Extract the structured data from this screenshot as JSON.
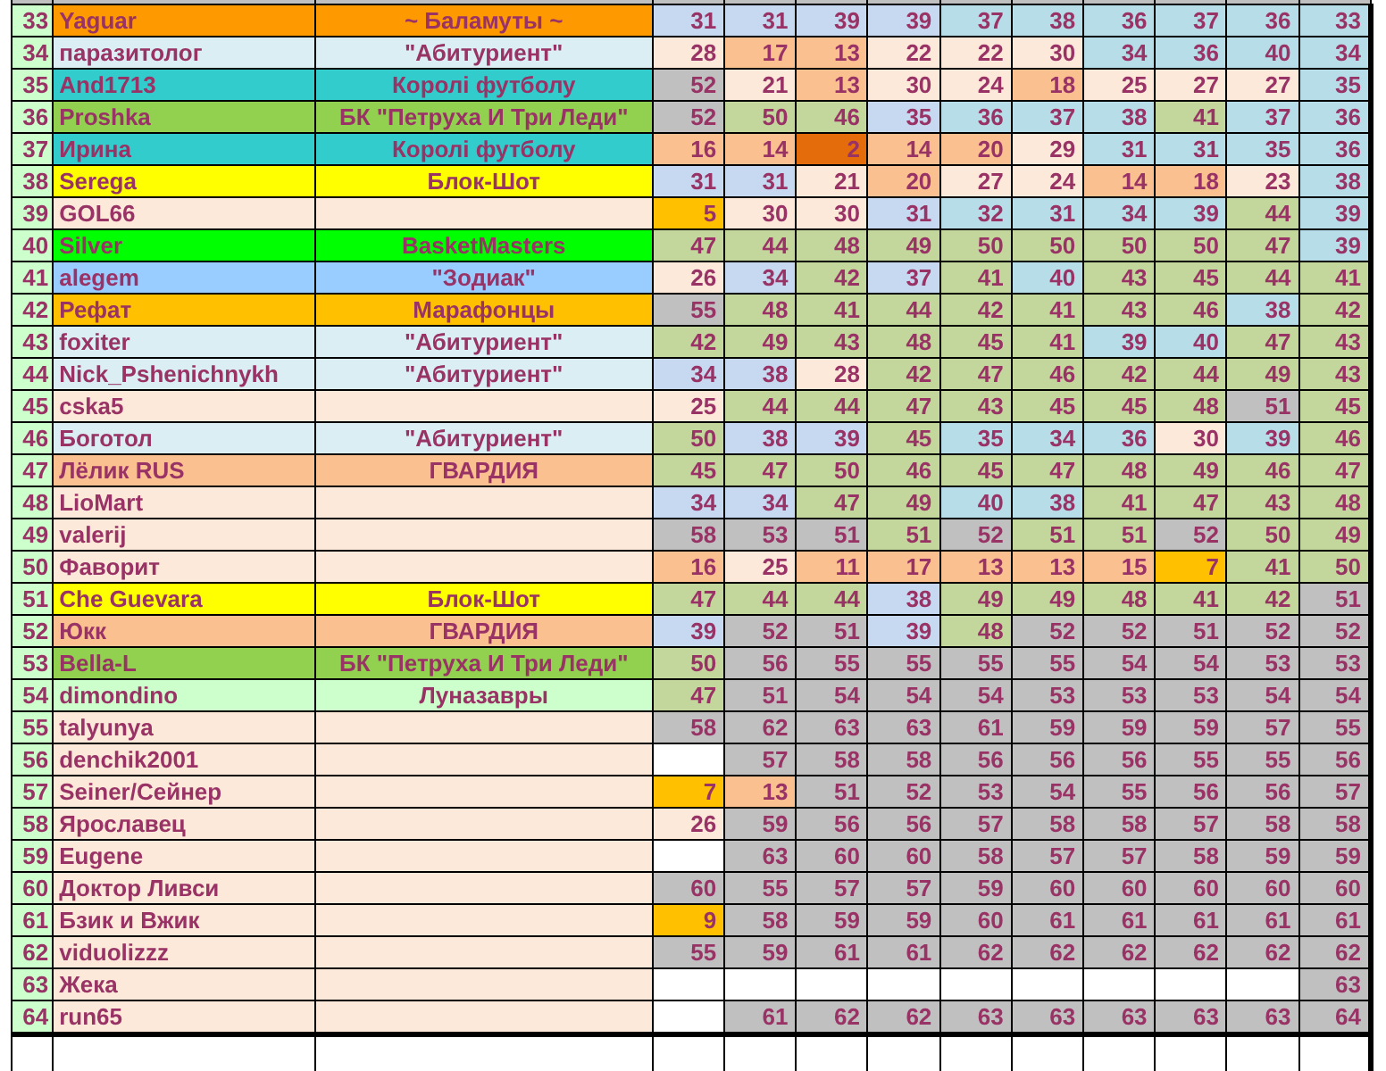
{
  "rows": [
    {
      "number": "33",
      "name": "Yaguar",
      "team": "~ Баламуты ~",
      "color": "#ff9900",
      "cells": [
        {
          "value": "31",
          "color": "#c6d9f0"
        },
        {
          "value": "31",
          "color": "#c6d9f0"
        },
        {
          "value": "39",
          "color": "#c6d9f0"
        },
        {
          "value": "39",
          "color": "#c6d9f0"
        },
        {
          "value": "37",
          "color": "#b7dde8"
        },
        {
          "value": "38",
          "color": "#b7dde8"
        },
        {
          "value": "36",
          "color": "#b7dde8"
        },
        {
          "value": "37",
          "color": "#b7dde8"
        },
        {
          "value": "36",
          "color": "#b7dde8"
        },
        {
          "value": "33",
          "color": "#b7dde8"
        }
      ]
    },
    {
      "number": "34",
      "name": "паразитолог",
      "team": "\"Абитуриент\"",
      "color": "#daeef3",
      "cells": [
        {
          "value": "28",
          "color": "#fde9d9"
        },
        {
          "value": "17",
          "color": "#fac090"
        },
        {
          "value": "13",
          "color": "#fac090"
        },
        {
          "value": "22",
          "color": "#fde9d9"
        },
        {
          "value": "22",
          "color": "#fde9d9"
        },
        {
          "value": "30",
          "color": "#fde9d9"
        },
        {
          "value": "34",
          "color": "#b7dde8"
        },
        {
          "value": "36",
          "color": "#b7dde8"
        },
        {
          "value": "40",
          "color": "#b7dde8"
        },
        {
          "value": "34",
          "color": "#b7dde8"
        }
      ]
    },
    {
      "number": "35",
      "name": "And1713",
      "team": "Королі футболу",
      "color": "#33cccc",
      "cells": [
        {
          "value": "52",
          "color": "#c0c0c0"
        },
        {
          "value": "21",
          "color": "#fde9d9"
        },
        {
          "value": "13",
          "color": "#fac090"
        },
        {
          "value": "30",
          "color": "#fde9d9"
        },
        {
          "value": "24",
          "color": "#fde9d9"
        },
        {
          "value": "18",
          "color": "#fac090"
        },
        {
          "value": "25",
          "color": "#fde9d9"
        },
        {
          "value": "27",
          "color": "#fde9d9"
        },
        {
          "value": "27",
          "color": "#fde9d9"
        },
        {
          "value": "35",
          "color": "#b7dde8"
        }
      ]
    },
    {
      "number": "36",
      "name": "Proshka",
      "team": "БК \"Петруха И Три Леди\"",
      "color": "#92d050",
      "cells": [
        {
          "value": "52",
          "color": "#c0c0c0"
        },
        {
          "value": "50",
          "color": "#c3d69b"
        },
        {
          "value": "46",
          "color": "#c3d69b"
        },
        {
          "value": "35",
          "color": "#c6d9f0"
        },
        {
          "value": "36",
          "color": "#b7dde8"
        },
        {
          "value": "37",
          "color": "#b7dde8"
        },
        {
          "value": "38",
          "color": "#b7dde8"
        },
        {
          "value": "41",
          "color": "#c3d69b"
        },
        {
          "value": "37",
          "color": "#b7dde8"
        },
        {
          "value": "36",
          "color": "#b7dde8"
        }
      ]
    },
    {
      "number": "37",
      "name": "Ирина",
      "team": "Королі футболу",
      "color": "#33cccc",
      "cells": [
        {
          "value": "16",
          "color": "#fac090"
        },
        {
          "value": "14",
          "color": "#fac090"
        },
        {
          "value": "2",
          "color": "#e46c0a"
        },
        {
          "value": "14",
          "color": "#fac090"
        },
        {
          "value": "20",
          "color": "#fac090"
        },
        {
          "value": "29",
          "color": "#fde9d9"
        },
        {
          "value": "31",
          "color": "#b7dde8"
        },
        {
          "value": "31",
          "color": "#b7dde8"
        },
        {
          "value": "35",
          "color": "#b7dde8"
        },
        {
          "value": "36",
          "color": "#b7dde8"
        }
      ]
    },
    {
      "number": "38",
      "name": "Serega",
      "team": "Блок-Шот",
      "color": "#ffff00",
      "cells": [
        {
          "value": "31",
          "color": "#c6d9f0"
        },
        {
          "value": "31",
          "color": "#c6d9f0"
        },
        {
          "value": "21",
          "color": "#fde9d9"
        },
        {
          "value": "20",
          "color": "#fac090"
        },
        {
          "value": "27",
          "color": "#fde9d9"
        },
        {
          "value": "24",
          "color": "#fde9d9"
        },
        {
          "value": "14",
          "color": "#fac090"
        },
        {
          "value": "18",
          "color": "#fac090"
        },
        {
          "value": "23",
          "color": "#fde9d9"
        },
        {
          "value": "38",
          "color": "#b7dde8"
        }
      ]
    },
    {
      "number": "39",
      "name": "GOL66",
      "color": "#fde9d9",
      "cells": [
        {
          "value": "5",
          "color": "#ffc000"
        },
        {
          "value": "30",
          "color": "#fde9d9"
        },
        {
          "value": "30",
          "color": "#fde9d9"
        },
        {
          "value": "31",
          "color": "#c6d9f0"
        },
        {
          "value": "32",
          "color": "#b7dde8"
        },
        {
          "value": "31",
          "color": "#b7dde8"
        },
        {
          "value": "34",
          "color": "#b7dde8"
        },
        {
          "value": "39",
          "color": "#b7dde8"
        },
        {
          "value": "44",
          "color": "#c3d69b"
        },
        {
          "value": "39",
          "color": "#b7dde8"
        }
      ]
    },
    {
      "number": "40",
      "name": "Silver",
      "team": "BasketMasters",
      "color": "#00ff00",
      "cells": [
        {
          "value": "47",
          "color": "#c3d69b"
        },
        {
          "value": "44",
          "color": "#c3d69b"
        },
        {
          "value": "48",
          "color": "#c3d69b"
        },
        {
          "value": "49",
          "color": "#c3d69b"
        },
        {
          "value": "50",
          "color": "#c3d69b"
        },
        {
          "value": "50",
          "color": "#c3d69b"
        },
        {
          "value": "50",
          "color": "#c3d69b"
        },
        {
          "value": "50",
          "color": "#c3d69b"
        },
        {
          "value": "47",
          "color": "#c3d69b"
        },
        {
          "value": "39",
          "color": "#b7dde8"
        }
      ]
    },
    {
      "number": "41",
      "name": "alegem",
      "team": "\"Зодиак\"",
      "color": "#99ccff",
      "cells": [
        {
          "value": "26",
          "color": "#fde9d9"
        },
        {
          "value": "34",
          "color": "#c6d9f0"
        },
        {
          "value": "42",
          "color": "#c3d69b"
        },
        {
          "value": "37",
          "color": "#c6d9f0"
        },
        {
          "value": "41",
          "color": "#c3d69b"
        },
        {
          "value": "40",
          "color": "#b7dde8"
        },
        {
          "value": "43",
          "color": "#c3d69b"
        },
        {
          "value": "45",
          "color": "#c3d69b"
        },
        {
          "value": "44",
          "color": "#c3d69b"
        },
        {
          "value": "41",
          "color": "#c3d69b"
        }
      ]
    },
    {
      "number": "42",
      "name": "Рефат",
      "team": "Марафонцы",
      "color": "#ffc000",
      "cells": [
        {
          "value": "55",
          "color": "#c0c0c0"
        },
        {
          "value": "48",
          "color": "#c3d69b"
        },
        {
          "value": "41",
          "color": "#c3d69b"
        },
        {
          "value": "44",
          "color": "#c3d69b"
        },
        {
          "value": "42",
          "color": "#c3d69b"
        },
        {
          "value": "41",
          "color": "#c3d69b"
        },
        {
          "value": "43",
          "color": "#c3d69b"
        },
        {
          "value": "46",
          "color": "#c3d69b"
        },
        {
          "value": "38",
          "color": "#b7dde8"
        },
        {
          "value": "42",
          "color": "#c3d69b"
        }
      ]
    },
    {
      "number": "43",
      "name": "foxiter",
      "team": "\"Абитуриент\"",
      "color": "#daeef3",
      "cells": [
        {
          "value": "42",
          "color": "#c3d69b"
        },
        {
          "value": "49",
          "color": "#c3d69b"
        },
        {
          "value": "43",
          "color": "#c3d69b"
        },
        {
          "value": "48",
          "color": "#c3d69b"
        },
        {
          "value": "45",
          "color": "#c3d69b"
        },
        {
          "value": "41",
          "color": "#c3d69b"
        },
        {
          "value": "39",
          "color": "#b7dde8"
        },
        {
          "value": "40",
          "color": "#b7dde8"
        },
        {
          "value": "47",
          "color": "#c3d69b"
        },
        {
          "value": "43",
          "color": "#c3d69b"
        }
      ]
    },
    {
      "number": "44",
      "name": "Nick_Pshenichnykh",
      "team": "\"Абитуриент\"",
      "color": "#daeef3",
      "cells": [
        {
          "value": "34",
          "color": "#c6d9f0"
        },
        {
          "value": "38",
          "color": "#c6d9f0"
        },
        {
          "value": "28",
          "color": "#fde9d9"
        },
        {
          "value": "42",
          "color": "#c3d69b"
        },
        {
          "value": "47",
          "color": "#c3d69b"
        },
        {
          "value": "46",
          "color": "#c3d69b"
        },
        {
          "value": "42",
          "color": "#c3d69b"
        },
        {
          "value": "44",
          "color": "#c3d69b"
        },
        {
          "value": "49",
          "color": "#c3d69b"
        },
        {
          "value": "43",
          "color": "#c3d69b"
        }
      ]
    },
    {
      "number": "45",
      "name": "cska5",
      "color": "#fde9d9",
      "cells": [
        {
          "value": "25",
          "color": "#fde9d9"
        },
        {
          "value": "44",
          "color": "#c3d69b"
        },
        {
          "value": "44",
          "color": "#c3d69b"
        },
        {
          "value": "47",
          "color": "#c3d69b"
        },
        {
          "value": "43",
          "color": "#c3d69b"
        },
        {
          "value": "45",
          "color": "#c3d69b"
        },
        {
          "value": "45",
          "color": "#c3d69b"
        },
        {
          "value": "48",
          "color": "#c3d69b"
        },
        {
          "value": "51",
          "color": "#c0c0c0"
        },
        {
          "value": "45",
          "color": "#c3d69b"
        }
      ]
    },
    {
      "number": "46",
      "name": "Боготол",
      "team": "\"Абитуриент\"",
      "color": "#daeef3",
      "cells": [
        {
          "value": "50",
          "color": "#c3d69b"
        },
        {
          "value": "38",
          "color": "#c6d9f0"
        },
        {
          "value": "39",
          "color": "#c6d9f0"
        },
        {
          "value": "45",
          "color": "#c3d69b"
        },
        {
          "value": "35",
          "color": "#b7dde8"
        },
        {
          "value": "34",
          "color": "#b7dde8"
        },
        {
          "value": "36",
          "color": "#b7dde8"
        },
        {
          "value": "30",
          "color": "#fde9d9"
        },
        {
          "value": "39",
          "color": "#b7dde8"
        },
        {
          "value": "46",
          "color": "#c3d69b"
        }
      ]
    },
    {
      "number": "47",
      "name": "Лёлик RUS",
      "team": "ГВАРДИЯ",
      "color": "#fac090",
      "cells": [
        {
          "value": "45",
          "color": "#c3d69b"
        },
        {
          "value": "47",
          "color": "#c3d69b"
        },
        {
          "value": "50",
          "color": "#c3d69b"
        },
        {
          "value": "46",
          "color": "#c3d69b"
        },
        {
          "value": "45",
          "color": "#c3d69b"
        },
        {
          "value": "47",
          "color": "#c3d69b"
        },
        {
          "value": "48",
          "color": "#c3d69b"
        },
        {
          "value": "49",
          "color": "#c3d69b"
        },
        {
          "value": "46",
          "color": "#c3d69b"
        },
        {
          "value": "47",
          "color": "#c3d69b"
        }
      ]
    },
    {
      "number": "48",
      "name": "LioMart",
      "color": "#fde9d9",
      "cells": [
        {
          "value": "34",
          "color": "#c6d9f0"
        },
        {
          "value": "34",
          "color": "#c6d9f0"
        },
        {
          "value": "47",
          "color": "#c3d69b"
        },
        {
          "value": "49",
          "color": "#c3d69b"
        },
        {
          "value": "40",
          "color": "#b7dde8"
        },
        {
          "value": "38",
          "color": "#b7dde8"
        },
        {
          "value": "41",
          "color": "#c3d69b"
        },
        {
          "value": "47",
          "color": "#c3d69b"
        },
        {
          "value": "43",
          "color": "#c3d69b"
        },
        {
          "value": "48",
          "color": "#c3d69b"
        }
      ]
    },
    {
      "number": "49",
      "name": "valerij",
      "color": "#fde9d9",
      "cells": [
        {
          "value": "58",
          "color": "#c0c0c0"
        },
        {
          "value": "53",
          "color": "#c0c0c0"
        },
        {
          "value": "51",
          "color": "#c0c0c0"
        },
        {
          "value": "51",
          "color": "#c3d69b"
        },
        {
          "value": "52",
          "color": "#c0c0c0"
        },
        {
          "value": "51",
          "color": "#c3d69b"
        },
        {
          "value": "51",
          "color": "#c3d69b"
        },
        {
          "value": "52",
          "color": "#c0c0c0"
        },
        {
          "value": "50",
          "color": "#c3d69b"
        },
        {
          "value": "49",
          "color": "#c3d69b"
        }
      ]
    },
    {
      "number": "50",
      "name": "Фаворит",
      "color": "#fde9d9",
      "cells": [
        {
          "value": "16",
          "color": "#fac090"
        },
        {
          "value": "25",
          "color": "#fde9d9"
        },
        {
          "value": "11",
          "color": "#fac090"
        },
        {
          "value": "17",
          "color": "#fac090"
        },
        {
          "value": "13",
          "color": "#fac090"
        },
        {
          "value": "13",
          "color": "#fac090"
        },
        {
          "value": "15",
          "color": "#fac090"
        },
        {
          "value": "7",
          "color": "#ffc000"
        },
        {
          "value": "41",
          "color": "#c3d69b"
        },
        {
          "value": "50",
          "color": "#c3d69b"
        }
      ]
    },
    {
      "number": "51",
      "name": "Che Guevara",
      "team": "Блок-Шот",
      "color": "#ffff00",
      "cells": [
        {
          "value": "47",
          "color": "#c3d69b"
        },
        {
          "value": "44",
          "color": "#c3d69b"
        },
        {
          "value": "44",
          "color": "#c3d69b"
        },
        {
          "value": "38",
          "color": "#c6d9f0"
        },
        {
          "value": "49",
          "color": "#c3d69b"
        },
        {
          "value": "49",
          "color": "#c3d69b"
        },
        {
          "value": "48",
          "color": "#c3d69b"
        },
        {
          "value": "41",
          "color": "#c3d69b"
        },
        {
          "value": "42",
          "color": "#c3d69b"
        },
        {
          "value": "51",
          "color": "#c0c0c0"
        }
      ]
    },
    {
      "number": "52",
      "name": "Юкк",
      "team": "ГВАРДИЯ",
      "color": "#fac090",
      "cells": [
        {
          "value": "39",
          "color": "#c6d9f0"
        },
        {
          "value": "52",
          "color": "#c0c0c0"
        },
        {
          "value": "51",
          "color": "#c0c0c0"
        },
        {
          "value": "39",
          "color": "#c6d9f0"
        },
        {
          "value": "48",
          "color": "#c3d69b"
        },
        {
          "value": "52",
          "color": "#c0c0c0"
        },
        {
          "value": "52",
          "color": "#c0c0c0"
        },
        {
          "value": "51",
          "color": "#c0c0c0"
        },
        {
          "value": "52",
          "color": "#c0c0c0"
        },
        {
          "value": "52",
          "color": "#c0c0c0"
        }
      ]
    },
    {
      "number": "53",
      "name": "Bella-L",
      "team": "БК \"Петруха И Три Леди\"",
      "color": "#92d050",
      "cells": [
        {
          "value": "50",
          "color": "#c3d69b"
        },
        {
          "value": "56",
          "color": "#c0c0c0"
        },
        {
          "value": "55",
          "color": "#c0c0c0"
        },
        {
          "value": "55",
          "color": "#c0c0c0"
        },
        {
          "value": "55",
          "color": "#c0c0c0"
        },
        {
          "value": "55",
          "color": "#c0c0c0"
        },
        {
          "value": "54",
          "color": "#c0c0c0"
        },
        {
          "value": "54",
          "color": "#c0c0c0"
        },
        {
          "value": "53",
          "color": "#c0c0c0"
        },
        {
          "value": "53",
          "color": "#c0c0c0"
        }
      ]
    },
    {
      "number": "54",
      "name": "dimondino",
      "team": "Луназавры",
      "color": "#ccffcc",
      "cells": [
        {
          "value": "47",
          "color": "#c3d69b"
        },
        {
          "value": "51",
          "color": "#c0c0c0"
        },
        {
          "value": "54",
          "color": "#c0c0c0"
        },
        {
          "value": "54",
          "color": "#c0c0c0"
        },
        {
          "value": "54",
          "color": "#c0c0c0"
        },
        {
          "value": "53",
          "color": "#c0c0c0"
        },
        {
          "value": "53",
          "color": "#c0c0c0"
        },
        {
          "value": "53",
          "color": "#c0c0c0"
        },
        {
          "value": "54",
          "color": "#c0c0c0"
        },
        {
          "value": "54",
          "color": "#c0c0c0"
        }
      ]
    },
    {
      "number": "55",
      "name": "talyunya",
      "color": "#fde9d9",
      "cells": [
        {
          "value": "58",
          "color": "#c0c0c0"
        },
        {
          "value": "62",
          "color": "#c0c0c0"
        },
        {
          "value": "63",
          "color": "#c0c0c0"
        },
        {
          "value": "63",
          "color": "#c0c0c0"
        },
        {
          "value": "61",
          "color": "#c0c0c0"
        },
        {
          "value": "59",
          "color": "#c0c0c0"
        },
        {
          "value": "59",
          "color": "#c0c0c0"
        },
        {
          "value": "59",
          "color": "#c0c0c0"
        },
        {
          "value": "57",
          "color": "#c0c0c0"
        },
        {
          "value": "55",
          "color": "#c0c0c0"
        }
      ]
    },
    {
      "number": "56",
      "name": "denchik2001",
      "color": "#fde9d9",
      "cells": [
        {
          "color": "#ffffff"
        },
        {
          "value": "57",
          "color": "#c0c0c0"
        },
        {
          "value": "58",
          "color": "#c0c0c0"
        },
        {
          "value": "58",
          "color": "#c0c0c0"
        },
        {
          "value": "56",
          "color": "#c0c0c0"
        },
        {
          "value": "56",
          "color": "#c0c0c0"
        },
        {
          "value": "56",
          "color": "#c0c0c0"
        },
        {
          "value": "55",
          "color": "#c0c0c0"
        },
        {
          "value": "55",
          "color": "#c0c0c0"
        },
        {
          "value": "56",
          "color": "#c0c0c0"
        }
      ]
    },
    {
      "number": "57",
      "name": "Seiner/Сейнер",
      "color": "#fde9d9",
      "cells": [
        {
          "value": "7",
          "color": "#ffc000"
        },
        {
          "value": "13",
          "color": "#fac090"
        },
        {
          "value": "51",
          "color": "#c0c0c0"
        },
        {
          "value": "52",
          "color": "#c0c0c0"
        },
        {
          "value": "53",
          "color": "#c0c0c0"
        },
        {
          "value": "54",
          "color": "#c0c0c0"
        },
        {
          "value": "55",
          "color": "#c0c0c0"
        },
        {
          "value": "56",
          "color": "#c0c0c0"
        },
        {
          "value": "56",
          "color": "#c0c0c0"
        },
        {
          "value": "57",
          "color": "#c0c0c0"
        }
      ]
    },
    {
      "number": "58",
      "name": "Ярославец",
      "color": "#fde9d9",
      "cells": [
        {
          "value": "26",
          "color": "#fde9d9"
        },
        {
          "value": "59",
          "color": "#c0c0c0"
        },
        {
          "value": "56",
          "color": "#c0c0c0"
        },
        {
          "value": "56",
          "color": "#c0c0c0"
        },
        {
          "value": "57",
          "color": "#c0c0c0"
        },
        {
          "value": "58",
          "color": "#c0c0c0"
        },
        {
          "value": "58",
          "color": "#c0c0c0"
        },
        {
          "value": "57",
          "color": "#c0c0c0"
        },
        {
          "value": "58",
          "color": "#c0c0c0"
        },
        {
          "value": "58",
          "color": "#c0c0c0"
        }
      ]
    },
    {
      "number": "59",
      "name": "Eugene",
      "color": "#fde9d9",
      "cells": [
        {
          "color": "#ffffff"
        },
        {
          "value": "63",
          "color": "#c0c0c0"
        },
        {
          "value": "60",
          "color": "#c0c0c0"
        },
        {
          "value": "60",
          "color": "#c0c0c0"
        },
        {
          "value": "58",
          "color": "#c0c0c0"
        },
        {
          "value": "57",
          "color": "#c0c0c0"
        },
        {
          "value": "57",
          "color": "#c0c0c0"
        },
        {
          "value": "58",
          "color": "#c0c0c0"
        },
        {
          "value": "59",
          "color": "#c0c0c0"
        },
        {
          "value": "59",
          "color": "#c0c0c0"
        }
      ]
    },
    {
      "number": "60",
      "name": "Доктор Ливси",
      "color": "#fde9d9",
      "cells": [
        {
          "value": "60",
          "color": "#c0c0c0"
        },
        {
          "value": "55",
          "color": "#c0c0c0"
        },
        {
          "value": "57",
          "color": "#c0c0c0"
        },
        {
          "value": "57",
          "color": "#c0c0c0"
        },
        {
          "value": "59",
          "color": "#c0c0c0"
        },
        {
          "value": "60",
          "color": "#c0c0c0"
        },
        {
          "value": "60",
          "color": "#c0c0c0"
        },
        {
          "value": "60",
          "color": "#c0c0c0"
        },
        {
          "value": "60",
          "color": "#c0c0c0"
        },
        {
          "value": "60",
          "color": "#c0c0c0"
        }
      ]
    },
    {
      "number": "61",
      "name": "Бзик и Вжик",
      "color": "#fde9d9",
      "cells": [
        {
          "value": "9",
          "color": "#ffc000"
        },
        {
          "value": "58",
          "color": "#c0c0c0"
        },
        {
          "value": "59",
          "color": "#c0c0c0"
        },
        {
          "value": "59",
          "color": "#c0c0c0"
        },
        {
          "value": "60",
          "color": "#c0c0c0"
        },
        {
          "value": "61",
          "color": "#c0c0c0"
        },
        {
          "value": "61",
          "color": "#c0c0c0"
        },
        {
          "value": "61",
          "color": "#c0c0c0"
        },
        {
          "value": "61",
          "color": "#c0c0c0"
        },
        {
          "value": "61",
          "color": "#c0c0c0"
        }
      ]
    },
    {
      "number": "62",
      "name": "viduolizzz",
      "color": "#fde9d9",
      "cells": [
        {
          "value": "55",
          "color": "#c0c0c0"
        },
        {
          "value": "59",
          "color": "#c0c0c0"
        },
        {
          "value": "61",
          "color": "#c0c0c0"
        },
        {
          "value": "61",
          "color": "#c0c0c0"
        },
        {
          "value": "62",
          "color": "#c0c0c0"
        },
        {
          "value": "62",
          "color": "#c0c0c0"
        },
        {
          "value": "62",
          "color": "#c0c0c0"
        },
        {
          "value": "62",
          "color": "#c0c0c0"
        },
        {
          "value": "62",
          "color": "#c0c0c0"
        },
        {
          "value": "62",
          "color": "#c0c0c0"
        }
      ]
    },
    {
      "number": "63",
      "name": "Жека",
      "color": "#fde9d9",
      "cells": [
        {
          "color": "#ffffff"
        },
        {
          "color": "#ffffff"
        },
        {
          "color": "#ffffff"
        },
        {
          "color": "#ffffff"
        },
        {
          "color": "#ffffff"
        },
        {
          "color": "#ffffff"
        },
        {
          "color": "#ffffff"
        },
        {
          "color": "#ffffff"
        },
        {
          "color": "#ffffff"
        },
        {
          "value": "63",
          "color": "#c0c0c0"
        }
      ]
    },
    {
      "number": "64",
      "name": "run65",
      "color": "#fde9d9",
      "cells": [
        {
          "color": "#ffffff"
        },
        {
          "value": "61",
          "color": "#c0c0c0"
        },
        {
          "value": "62",
          "color": "#c0c0c0"
        },
        {
          "value": "62",
          "color": "#c0c0c0"
        },
        {
          "value": "63",
          "color": "#c0c0c0"
        },
        {
          "value": "63",
          "color": "#c0c0c0"
        },
        {
          "value": "63",
          "color": "#c0c0c0"
        },
        {
          "value": "63",
          "color": "#c0c0c0"
        },
        {
          "value": "63",
          "color": "#c0c0c0"
        },
        {
          "value": "64",
          "color": "#c0c0c0"
        }
      ]
    }
  ]
}
